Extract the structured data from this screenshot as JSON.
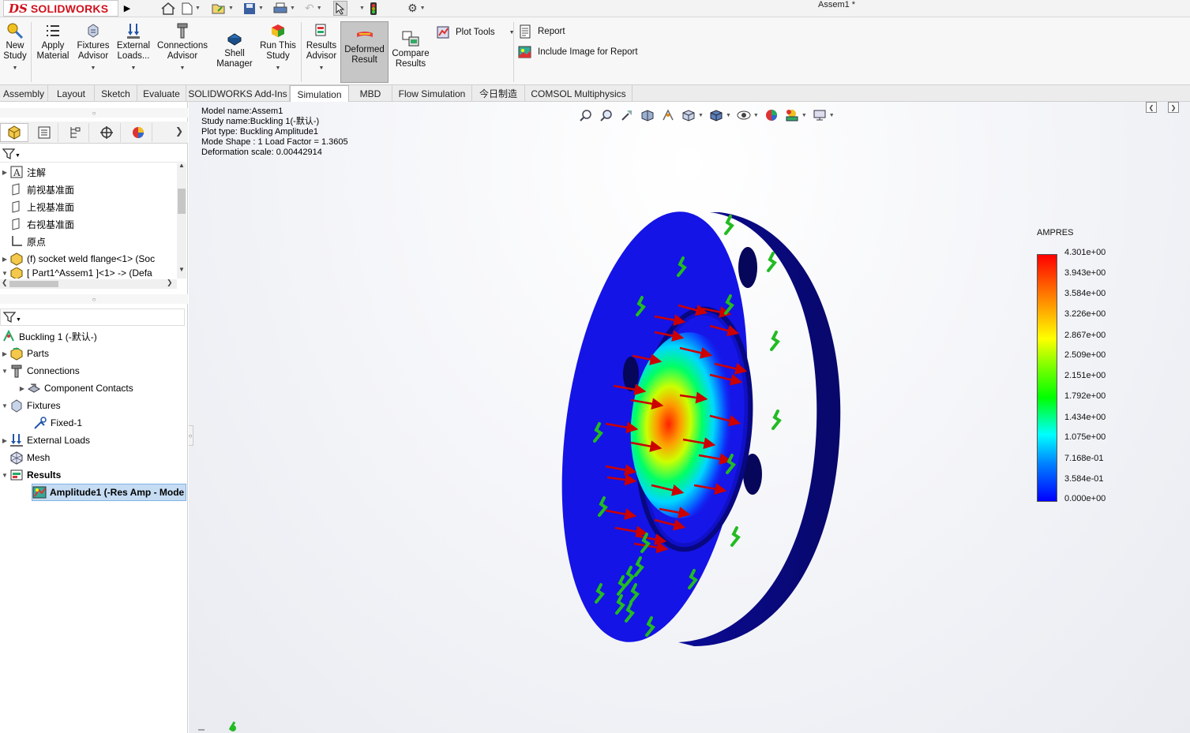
{
  "app": {
    "brand_prefix": "DS",
    "brand_name": "SOLIDWORKS",
    "document_title": "Assem1 *"
  },
  "ribbon": {
    "new_study": "New\nStudy",
    "apply_material": "Apply\nMaterial",
    "fixtures_advisor": "Fixtures\nAdvisor",
    "external_loads": "External\nLoads...",
    "connections_advisor": "Connections\nAdvisor",
    "shell_manager": "Shell\nManager",
    "run_this_study": "Run This\nStudy",
    "results_advisor": "Results\nAdvisor",
    "deformed_result": "Deformed\nResult",
    "compare_results": "Compare\nResults",
    "plot_tools": "Plot Tools",
    "report": "Report",
    "include_image": "Include Image for Report"
  },
  "tabs": [
    "Assembly",
    "Layout",
    "Sketch",
    "Evaluate",
    "SOLIDWORKS Add-Ins",
    "Simulation",
    "MBD",
    "Flow Simulation",
    "今日制造",
    "COMSOL Multiphysics"
  ],
  "active_tab": "Simulation",
  "feature_tree": {
    "items": [
      {
        "label": "注解"
      },
      {
        "label": "前视基准面"
      },
      {
        "label": "上视基准面"
      },
      {
        "label": "右视基准面"
      },
      {
        "label": "原点"
      },
      {
        "label": "(f) socket weld flange<1> (Soc"
      },
      {
        "label": "[ Part1^Assem1 ]<1> -> (Defa"
      }
    ]
  },
  "study_tree": {
    "study": "Buckling 1 (-默认-)",
    "parts": "Parts",
    "connections": "Connections",
    "component_contacts": "Component Contacts",
    "fixtures": "Fixtures",
    "fixed": "Fixed-1",
    "external_loads": "External Loads",
    "mesh": "Mesh",
    "results": "Results",
    "amplitude": "Amplitude1 (-Res Amp - Mode"
  },
  "viewport": {
    "model_name": "Model name:Assem1",
    "study_name": "Study name:Buckling 1(-默认-)",
    "plot_type": "Plot type: Buckling Amplitude1",
    "mode_shape": "Mode Shape : 1  Load Factor = 1.3605",
    "deformation_scale": "Deformation scale: 0.00442914"
  },
  "legend": {
    "title": "AMPRES",
    "ticks": [
      "4.301e+00",
      "3.943e+00",
      "3.584e+00",
      "3.226e+00",
      "2.867e+00",
      "2.509e+00",
      "2.151e+00",
      "1.792e+00",
      "1.434e+00",
      "1.075e+00",
      "7.168e-01",
      "3.584e-01",
      "0.000e+00"
    ]
  },
  "colors": {
    "brand_red": "#d1111c",
    "mesh_blue": "#1414e6",
    "side_blue": "#0a0a8c",
    "load_arrow": "#cc0000",
    "fixture_green": "#22bb22",
    "selection": "#c5dcf3"
  }
}
